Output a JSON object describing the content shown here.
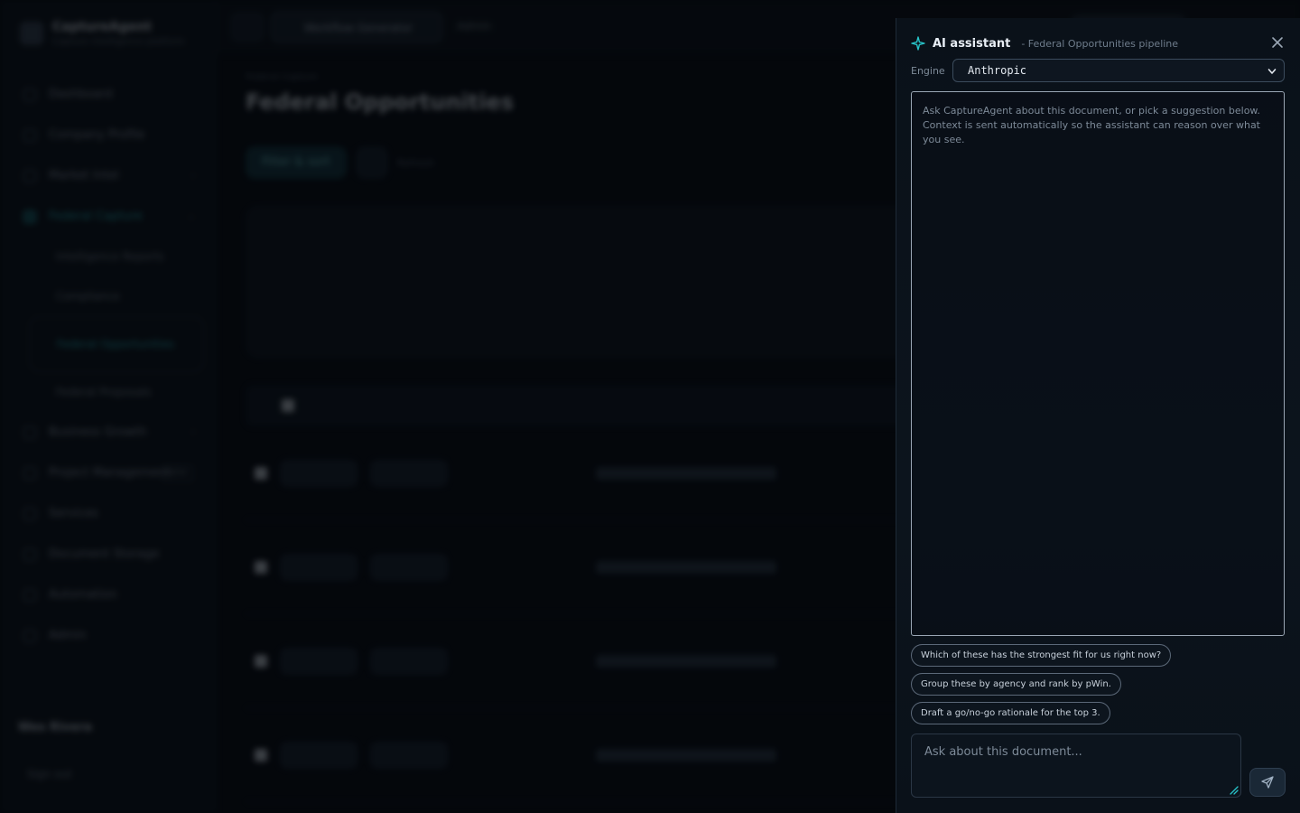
{
  "app": {
    "name": "CaptureAgent",
    "tagline": "Capture intelligence platform"
  },
  "sidebar": {
    "items": [
      {
        "label": "Dashboard"
      },
      {
        "label": "Company Profile"
      },
      {
        "label": "Market Intel"
      },
      {
        "label": "Federal Capture"
      }
    ],
    "sub_items": [
      {
        "label": "Intelligence Reports"
      },
      {
        "label": "Compliance"
      },
      {
        "label": "Federal Opportunities"
      },
      {
        "label": "Federal Proposals"
      }
    ],
    "lower_items": [
      {
        "label": "Business Growth"
      },
      {
        "label": "Project Management"
      },
      {
        "label": "Services"
      },
      {
        "label": "Document Storage"
      },
      {
        "label": "Automation"
      },
      {
        "label": "Admin"
      }
    ],
    "user": "Wes Rivera",
    "signout_label": "Sign out"
  },
  "topbar": {
    "active_tab": "Workflow Generator",
    "second_tab": "Admin"
  },
  "main": {
    "crumb": "Federal Capture",
    "title": "Federal Opportunities",
    "primary_action": "Filter & sort",
    "secondary_action": "Refresh"
  },
  "assistant": {
    "title": "AI assistant",
    "context": "- Federal Opportunities pipeline",
    "engine_label": "Engine",
    "engine_value": "Anthropic",
    "intro_text": "Ask CaptureAgent about this document, or pick a suggestion below. Context is sent automatically so the assistant can reason over what you see.",
    "suggestions": [
      "Which of these has the strongest fit for us right now?",
      "Group these by agency and rank by pWin.",
      "Draft a go/no-go rationale for the top 3."
    ],
    "input_placeholder": "Ask about this document...",
    "accent_color": "#28c4c9"
  }
}
